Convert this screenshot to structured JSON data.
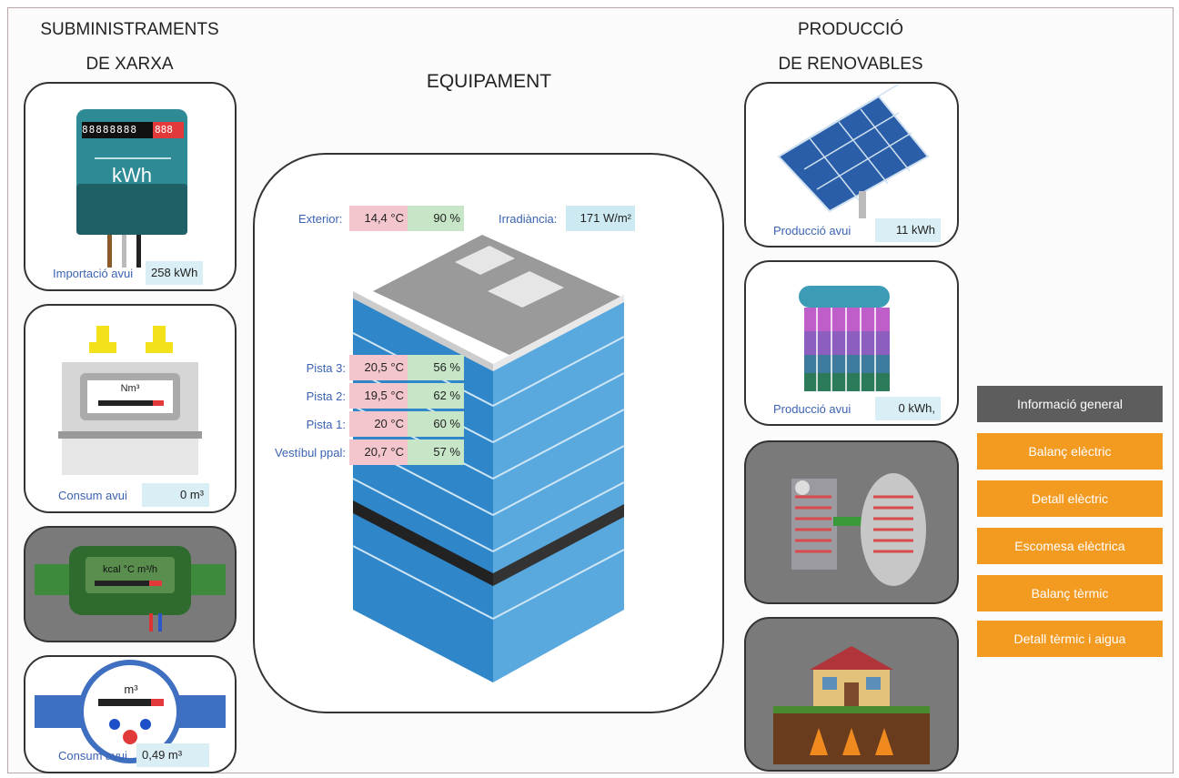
{
  "headings": {
    "supply_line1": "SUBMINISTRAMENTS",
    "supply_line2": "DE XARXA",
    "equipment": "EQUIPAMENT",
    "renew_line1": "PRODUCCIÓ",
    "renew_line2": "DE RENOVABLES"
  },
  "supply": {
    "electric": {
      "label": "Importació avui",
      "value": "258 kWh",
      "meter_digits": "88888888",
      "meter_red": "888",
      "unit": "kWh"
    },
    "gas": {
      "label": "Consum avui",
      "value": "0 m³",
      "unit": "Nm³"
    },
    "heat": {
      "unit": "kcal °C m³/h"
    },
    "water": {
      "label": "Consum avui",
      "value": "0,49 m³",
      "unit": "m³"
    }
  },
  "equipment": {
    "exterior": {
      "label": "Exterior:",
      "temp": "14,4 °C",
      "hum": "90 %"
    },
    "irradiance": {
      "label": "Irradiància:",
      "value": "171 W/m²"
    },
    "rooms": [
      {
        "label": "Pista 3:",
        "temp": "20,5 °C",
        "hum": "56 %"
      },
      {
        "label": "Pista 2:",
        "temp": "19,5 °C",
        "hum": "62 %"
      },
      {
        "label": "Pista 1:",
        "temp": "20 °C",
        "hum": "60 %"
      },
      {
        "label": "Vestíbul ppal:",
        "temp": "20,7 °C",
        "hum": "57 %"
      }
    ]
  },
  "renewables": {
    "solar_pv": {
      "label": "Producció avui",
      "value": "11 kWh"
    },
    "solar_thermal": {
      "label": "Producció avui",
      "value": "0 kWh,"
    }
  },
  "menu": {
    "header": "Informació general",
    "items": [
      "Balanç elèctric",
      "Detall elèctric",
      "Escomesa elèctrica",
      "Balanç tèrmic",
      "Detall tèrmic i aigua"
    ]
  },
  "colors": {
    "menu_orange": "#f39a20",
    "menu_grey": "#5d5d5d",
    "temp_bg": "#f3c6cd",
    "hum_bg": "#c6e6c7",
    "value_bg": "#d9eef5",
    "label_blue": "#3b63b2"
  }
}
